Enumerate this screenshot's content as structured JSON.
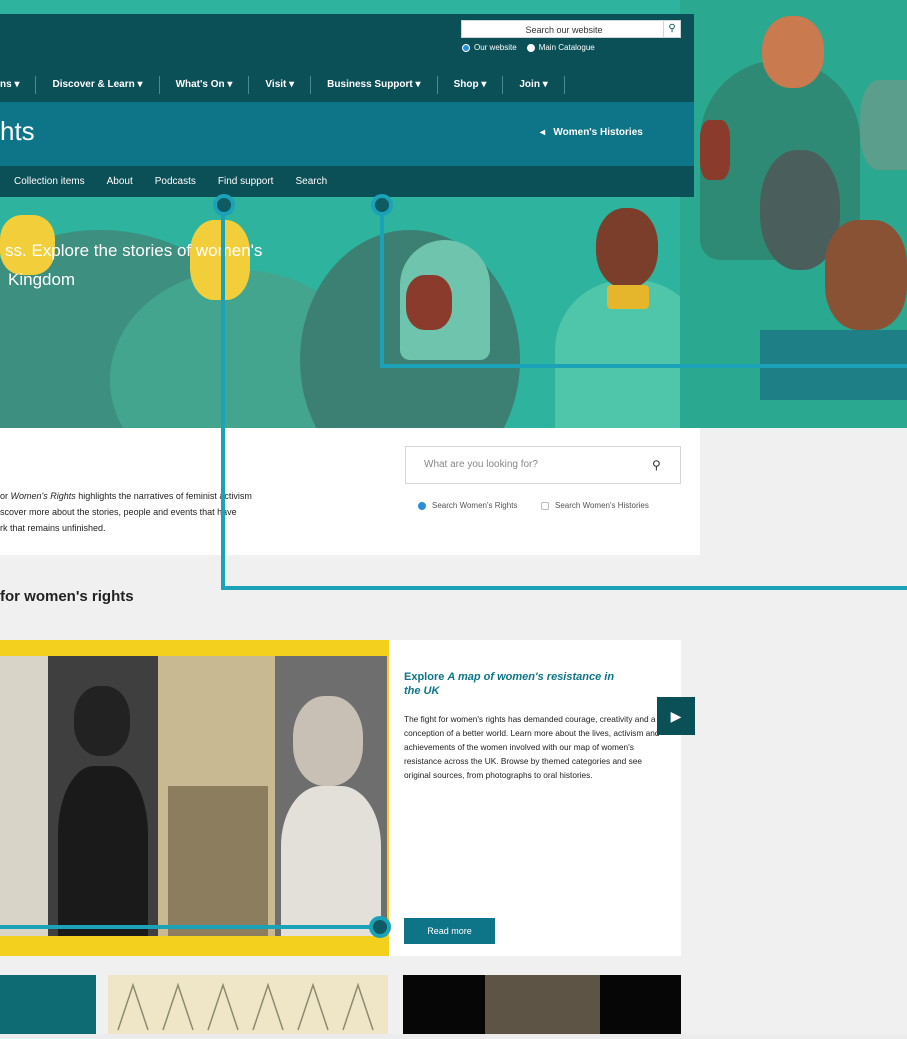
{
  "header": {
    "site_search_placeholder": "Search our website",
    "search_scope": [
      {
        "label": "Our website",
        "selected": true
      },
      {
        "label": "Main Catalogue",
        "selected": false
      }
    ],
    "nav": [
      {
        "label": "ns",
        "caret": "▾"
      },
      {
        "label": "Discover & Learn",
        "caret": "▾"
      },
      {
        "label": "What's On",
        "caret": "▾"
      },
      {
        "label": "Visit",
        "caret": "▾"
      },
      {
        "label": "Business Support",
        "caret": "▾"
      },
      {
        "label": "Shop",
        "caret": "▾"
      },
      {
        "label": "Join",
        "caret": "▾"
      }
    ]
  },
  "section": {
    "title": "hts",
    "back_link": "Women's Histories",
    "back_arrow": "◂",
    "subnav": [
      "Collection items",
      "About",
      "Podcasts",
      "Find support",
      "Search"
    ]
  },
  "hero": {
    "line1": "ss. Explore the stories of women's",
    "line2": "Kingdom"
  },
  "intro": {
    "line1_prefix": "or ",
    "line1_em": "Women's Rights",
    "line1_rest": " highlights the narratives of feminist activism",
    "line2": "scover more about the stories, people and events that have",
    "line3": "rk that remains unfinished."
  },
  "women_search": {
    "placeholder": "What are you looking for?",
    "icon": "search-icon",
    "options": [
      {
        "label": "Search Women's Rights",
        "selected": true
      },
      {
        "label": "Search Women's Histories",
        "selected": false
      }
    ]
  },
  "featured": {
    "heading": "for women's rights",
    "title_prefix": "Explore ",
    "title_em": "A map of women's resistance in the UK",
    "body": "The fight for women's rights has demanded courage, creativity and a conception of a better world. Learn more about the lives, activism and achievements of the women involved with our map of women's resistance across the UK. Browse by themed categories and see original sources, from photographs to oral histories.",
    "read_more": "Read more",
    "next_icon": "▶"
  },
  "colors": {
    "dark_teal": "#0b4f57",
    "teal": "#0e7588",
    "hero_green": "#2db39e",
    "callout": "#1ba1b8",
    "yellow": "#f3cf1e"
  }
}
